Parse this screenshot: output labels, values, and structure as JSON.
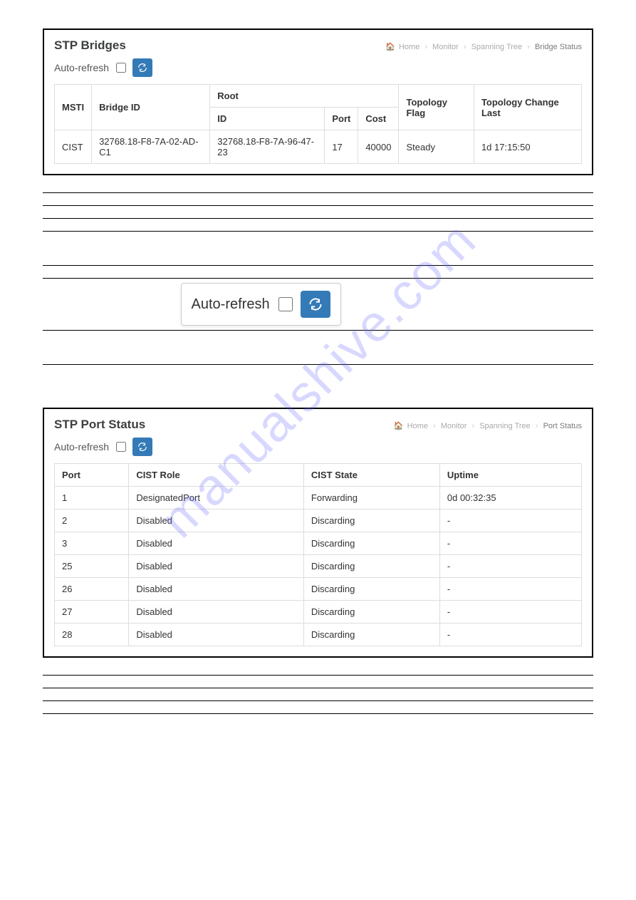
{
  "watermark": "manualshive.com",
  "stp_bridges": {
    "title": "STP Bridges",
    "breadcrumb": {
      "home": "Home",
      "monitor": "Monitor",
      "spanning": "Spanning Tree",
      "current": "Bridge Status"
    },
    "toolbar": {
      "auto_label": "Auto-refresh"
    },
    "headers": {
      "msti": "MSTI",
      "bridge_id": "Bridge ID",
      "root": "Root",
      "root_id": "ID",
      "port": "Port",
      "cost": "Cost",
      "topology_flag": "Topology Flag",
      "topology_change_last": "Topology Change Last"
    },
    "row": {
      "msti": "CIST",
      "bridge_id": "32768.18-F8-7A-02-AD-C1",
      "root_id": "32768.18-F8-7A-96-47-23",
      "port": "17",
      "cost": "40000",
      "flag": "Steady",
      "last": "1d 17:15:50"
    }
  },
  "big_refresh": {
    "auto_label": "Auto-refresh"
  },
  "stp_port_status": {
    "title": "STP Port Status",
    "breadcrumb": {
      "home": "Home",
      "monitor": "Monitor",
      "spanning": "Spanning Tree",
      "current": "Port Status"
    },
    "toolbar": {
      "auto_label": "Auto-refresh"
    },
    "headers": {
      "port": "Port",
      "role": "CIST Role",
      "state": "CIST State",
      "uptime": "Uptime"
    },
    "rows": [
      {
        "port": "1",
        "role": "DesignatedPort",
        "state": "Forwarding",
        "uptime": "0d 00:32:35"
      },
      {
        "port": "2",
        "role": "Disabled",
        "state": "Discarding",
        "uptime": "-"
      },
      {
        "port": "3",
        "role": "Disabled",
        "state": "Discarding",
        "uptime": "-"
      },
      {
        "port": "25",
        "role": "Disabled",
        "state": "Discarding",
        "uptime": "-"
      },
      {
        "port": "26",
        "role": "Disabled",
        "state": "Discarding",
        "uptime": "-"
      },
      {
        "port": "27",
        "role": "Disabled",
        "state": "Discarding",
        "uptime": "-"
      },
      {
        "port": "28",
        "role": "Disabled",
        "state": "Discarding",
        "uptime": "-"
      }
    ]
  }
}
